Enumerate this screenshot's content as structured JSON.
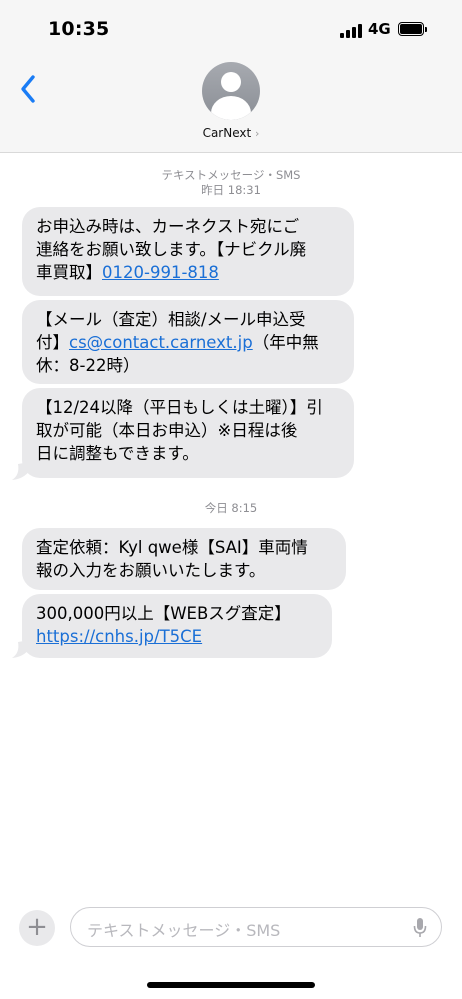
{
  "status_bar": {
    "time": "10:35",
    "network": "4G"
  },
  "header": {
    "contact_name": "CarNext",
    "chevron": "›"
  },
  "conversation": {
    "section1": {
      "label": "テキストメッセージ・SMS",
      "time": "昨日 18:31"
    },
    "bubble1": {
      "l1": " お申込み時は、カーネクスト宛にご",
      "l2": "連絡をお願い致します。【ナビクル廃",
      "l3a": "車買取】",
      "l3link": "0120-991-818"
    },
    "bubble2": {
      "l1": "【メール（査定）相談/メール申込受",
      "l2a": "付】",
      "l2link": "cs@contact.carnext.jp",
      "l2b": "（年中無",
      "l3": "休：8-22時）"
    },
    "bubble3": {
      "l1": "【12/24以降（平日もしくは土曜）】引",
      "l2": "取が可能（本日お申込）※日程は後",
      "l3": "日に調整もできます。"
    },
    "section2": {
      "time": "今日 8:15"
    },
    "bubble4": {
      "l1": "査定依頼：Kyl qwe様【SAI】車両情",
      "l2": "報の入力をお願いいたします。"
    },
    "bubble5": {
      "l1": "300,000円以上【WEBスグ査定】",
      "l2link": "https://cnhs.jp/T5CE"
    }
  },
  "input_bar": {
    "plus": "+",
    "placeholder": "テキストメッセージ・SMS"
  },
  "icons": {
    "back": "chevron-left-icon",
    "avatar": "person-icon",
    "mic": "microphone-icon"
  },
  "colors": {
    "accent": "#1a6fd6",
    "bubble_bg": "#e9e9eb",
    "meta_text": "#8e8e93"
  }
}
